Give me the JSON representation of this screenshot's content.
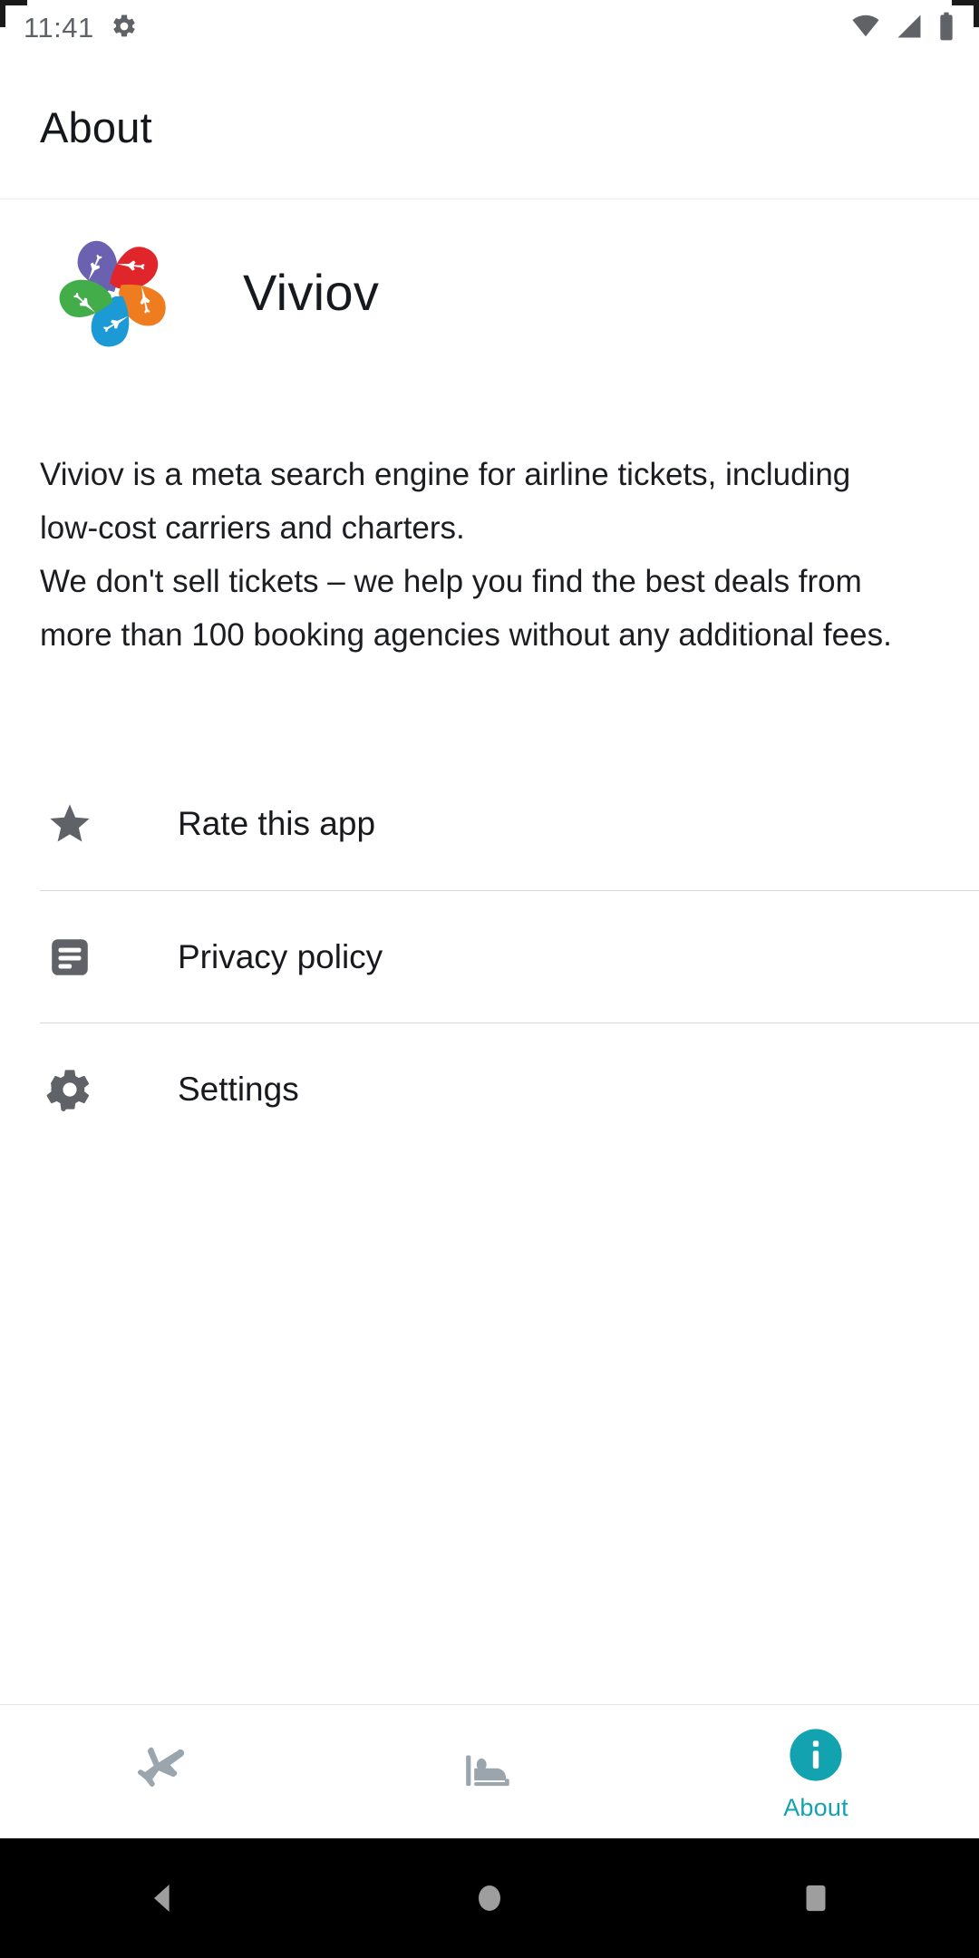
{
  "status_bar": {
    "time": "11:41",
    "icons": [
      "gear-icon",
      "wifi-icon",
      "cellular-signal-icon",
      "battery-icon"
    ]
  },
  "app_bar": {
    "title": "About"
  },
  "brand": {
    "logo_name": "viviov-logo",
    "name": "Viviov",
    "logo_colors": {
      "purple": "#6a62b0",
      "red": "#e0262a",
      "orange": "#f07c20",
      "blue": "#1b9ad6",
      "green": "#43ad49"
    }
  },
  "description": {
    "text": "Viviov is a meta search engine for airline tickets, including low-cost carriers and charters.\nWe don't sell tickets – we help you find the best deals from more than 100 booking agencies without any additional fees."
  },
  "menu": {
    "items": [
      {
        "label": "Rate this app",
        "icon": "star-icon"
      },
      {
        "label": "Privacy policy",
        "icon": "article-icon"
      },
      {
        "label": "Settings",
        "icon": "gear-icon"
      }
    ]
  },
  "tab_bar": {
    "accent_color": "#13a3b0",
    "inactive_color": "#9aa5ad",
    "tabs": [
      {
        "label": "",
        "icon": "airplane-icon",
        "active": false
      },
      {
        "label": "",
        "icon": "hotel-bed-icon",
        "active": false
      },
      {
        "label": "About",
        "icon": "info-icon",
        "active": true
      }
    ]
  },
  "system_nav": {
    "buttons": [
      {
        "name": "back-button",
        "icon": "triangle-back-icon"
      },
      {
        "name": "home-button",
        "icon": "circle-home-icon"
      },
      {
        "name": "recents-button",
        "icon": "square-recents-icon"
      }
    ]
  }
}
